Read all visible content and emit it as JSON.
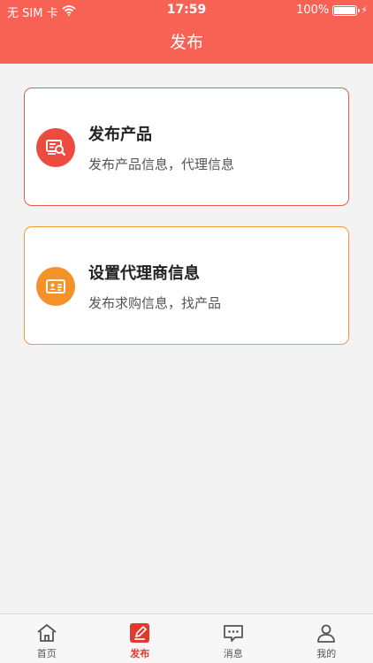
{
  "status_bar": {
    "carrier": "无 SIM 卡",
    "time": "17:59",
    "battery": "100%",
    "battery_level": 1.0,
    "wifi_icon": "wifi-icon",
    "charging_icon": "bolt-icon"
  },
  "header": {
    "title": "发布"
  },
  "cards": [
    {
      "title": "发布产品",
      "subtitle": "发布产品信息，代理信息",
      "icon": "product-search-icon",
      "color": "#ec4b3f"
    },
    {
      "title": "设置代理商信息",
      "subtitle": "发布求购信息，找产品",
      "icon": "id-card-icon",
      "color": "#f49128"
    }
  ],
  "tab_bar": {
    "items": [
      {
        "label": "首页",
        "icon": "home-icon",
        "active": false
      },
      {
        "label": "发布",
        "icon": "edit-icon",
        "active": true
      },
      {
        "label": "消息",
        "icon": "message-icon",
        "active": false
      },
      {
        "label": "我的",
        "icon": "user-icon",
        "active": false
      }
    ],
    "active_color": "#e2392c"
  }
}
